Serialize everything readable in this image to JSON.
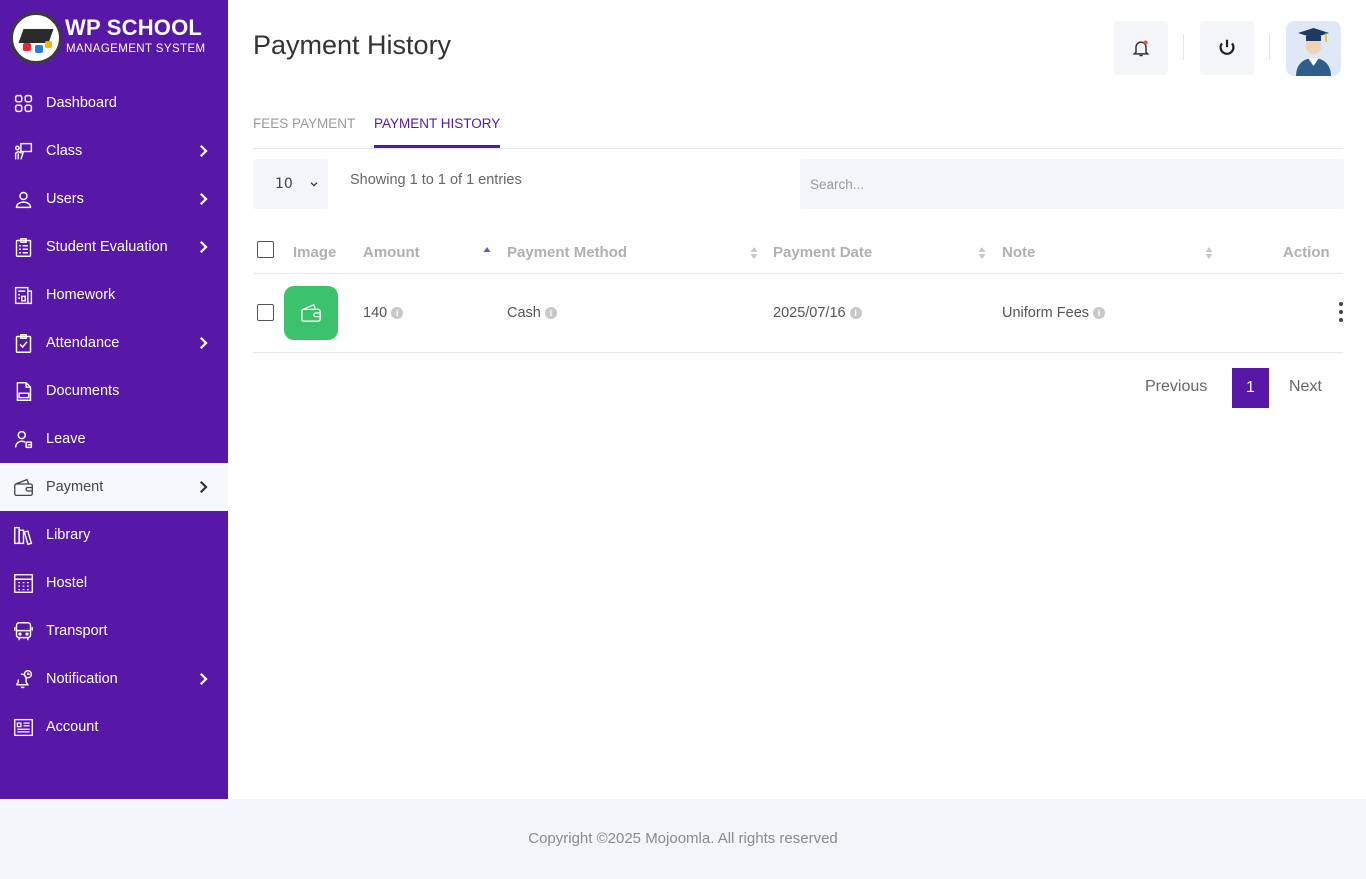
{
  "app": {
    "logo_title": "WP SCHOOL",
    "logo_subtitle": "MANAGEMENT SYSTEM"
  },
  "sidebar": {
    "items": [
      {
        "label": "Dashboard",
        "icon": "dashboard-icon",
        "has_submenu": false,
        "active": false
      },
      {
        "label": "Class",
        "icon": "class-icon",
        "has_submenu": true,
        "active": false
      },
      {
        "label": "Users",
        "icon": "user-icon",
        "has_submenu": true,
        "active": false
      },
      {
        "label": "Student Evaluation",
        "icon": "clipboard-icon",
        "has_submenu": true,
        "active": false
      },
      {
        "label": "Homework",
        "icon": "homework-icon",
        "has_submenu": false,
        "active": false
      },
      {
        "label": "Attendance",
        "icon": "attendance-icon",
        "has_submenu": true,
        "active": false
      },
      {
        "label": "Documents",
        "icon": "document-icon",
        "has_submenu": false,
        "active": false
      },
      {
        "label": "Leave",
        "icon": "leave-icon",
        "has_submenu": false,
        "active": false
      },
      {
        "label": "Payment",
        "icon": "wallet-icon",
        "has_submenu": true,
        "active": true
      },
      {
        "label": "Library",
        "icon": "library-icon",
        "has_submenu": false,
        "active": false
      },
      {
        "label": "Hostel",
        "icon": "hostel-icon",
        "has_submenu": false,
        "active": false
      },
      {
        "label": "Transport",
        "icon": "bus-icon",
        "has_submenu": false,
        "active": false
      },
      {
        "label": "Notification",
        "icon": "notification-icon",
        "has_submenu": true,
        "active": false
      },
      {
        "label": "Account",
        "icon": "account-icon",
        "has_submenu": false,
        "active": false
      }
    ]
  },
  "header": {
    "title": "Payment History"
  },
  "tabs": [
    {
      "label": "FEES PAYMENT",
      "active": false
    },
    {
      "label": "PAYMENT HISTORY",
      "active": true
    }
  ],
  "table_controls": {
    "page_length": "10",
    "showing": "Showing 1 to 1 of 1 entries",
    "search_placeholder": "Search..."
  },
  "table": {
    "columns": [
      "Image",
      "Amount",
      "Payment Method",
      "Payment Date",
      "Note",
      "Action"
    ],
    "rows": [
      {
        "amount": "140",
        "method": "Cash",
        "date": "2025/07/16",
        "note": "Uniform Fees"
      }
    ]
  },
  "pagination": {
    "previous": "Previous",
    "current": "1",
    "next": "Next"
  },
  "footer": {
    "text": "Copyright ©2025 Mojoomla. All rights reserved"
  },
  "colors": {
    "primary": "#5718a7",
    "payment_icon_bg": "#3cc16c",
    "active_nav_bg": "#f5f9fc"
  }
}
